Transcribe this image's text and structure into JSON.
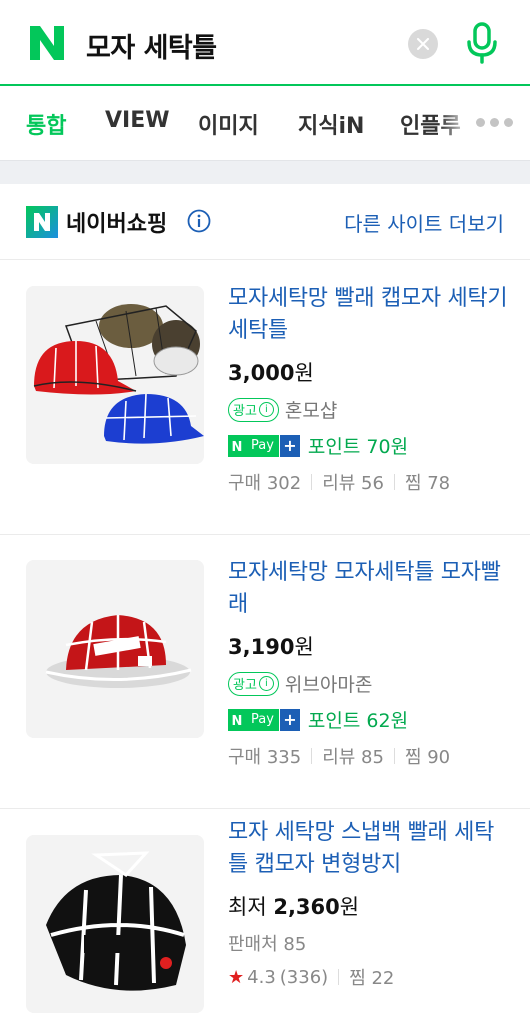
{
  "search": {
    "query": "모자 세탁틀"
  },
  "tabs": [
    {
      "label": "통합",
      "active": true
    },
    {
      "label": "VIEW",
      "active": false
    },
    {
      "label": "이미지",
      "active": false
    },
    {
      "label": "지식iN",
      "active": false
    },
    {
      "label": "인플루",
      "active": false
    }
  ],
  "shopping": {
    "title": "네이버쇼핑",
    "more_link": "다른 사이트 더보기",
    "ad_label": "광고",
    "products": [
      {
        "title": "모자세탁망 빨래 캡모자 세탁기 세탁틀",
        "price": "3,000",
        "price_unit": "원",
        "seller": "혼모샵",
        "points": "포인트 70원",
        "stats": {
          "purchase": "구매 302",
          "review": "리뷰 56",
          "wish": "찜 78"
        }
      },
      {
        "title": "모자세탁망 모자세탁틀 모자빨래",
        "price": "3,190",
        "price_unit": "원",
        "seller": "위브아마존",
        "points": "포인트 62원",
        "stats": {
          "purchase": "구매 335",
          "review": "리뷰 85",
          "wish": "찜 90"
        }
      },
      {
        "title": "모자 세탁망 스냅백 빨래 세탁틀 캡모자 변형방지",
        "price_prefix": "최저",
        "price": "2,360",
        "price_unit": "원",
        "sellers": "판매처 85",
        "rating": "4.3",
        "rating_count": "(336)",
        "wish": "찜 22"
      }
    ]
  },
  "colors": {
    "naver_green": "#03c75a",
    "link_blue": "#1c5fb5",
    "star_red": "#e02020"
  },
  "icons": [
    "naver-logo-icon",
    "clear-icon",
    "microphone-icon",
    "more-dots-icon",
    "naver-shopping-logo-icon",
    "info-icon",
    "npay-icon",
    "star-icon"
  ]
}
